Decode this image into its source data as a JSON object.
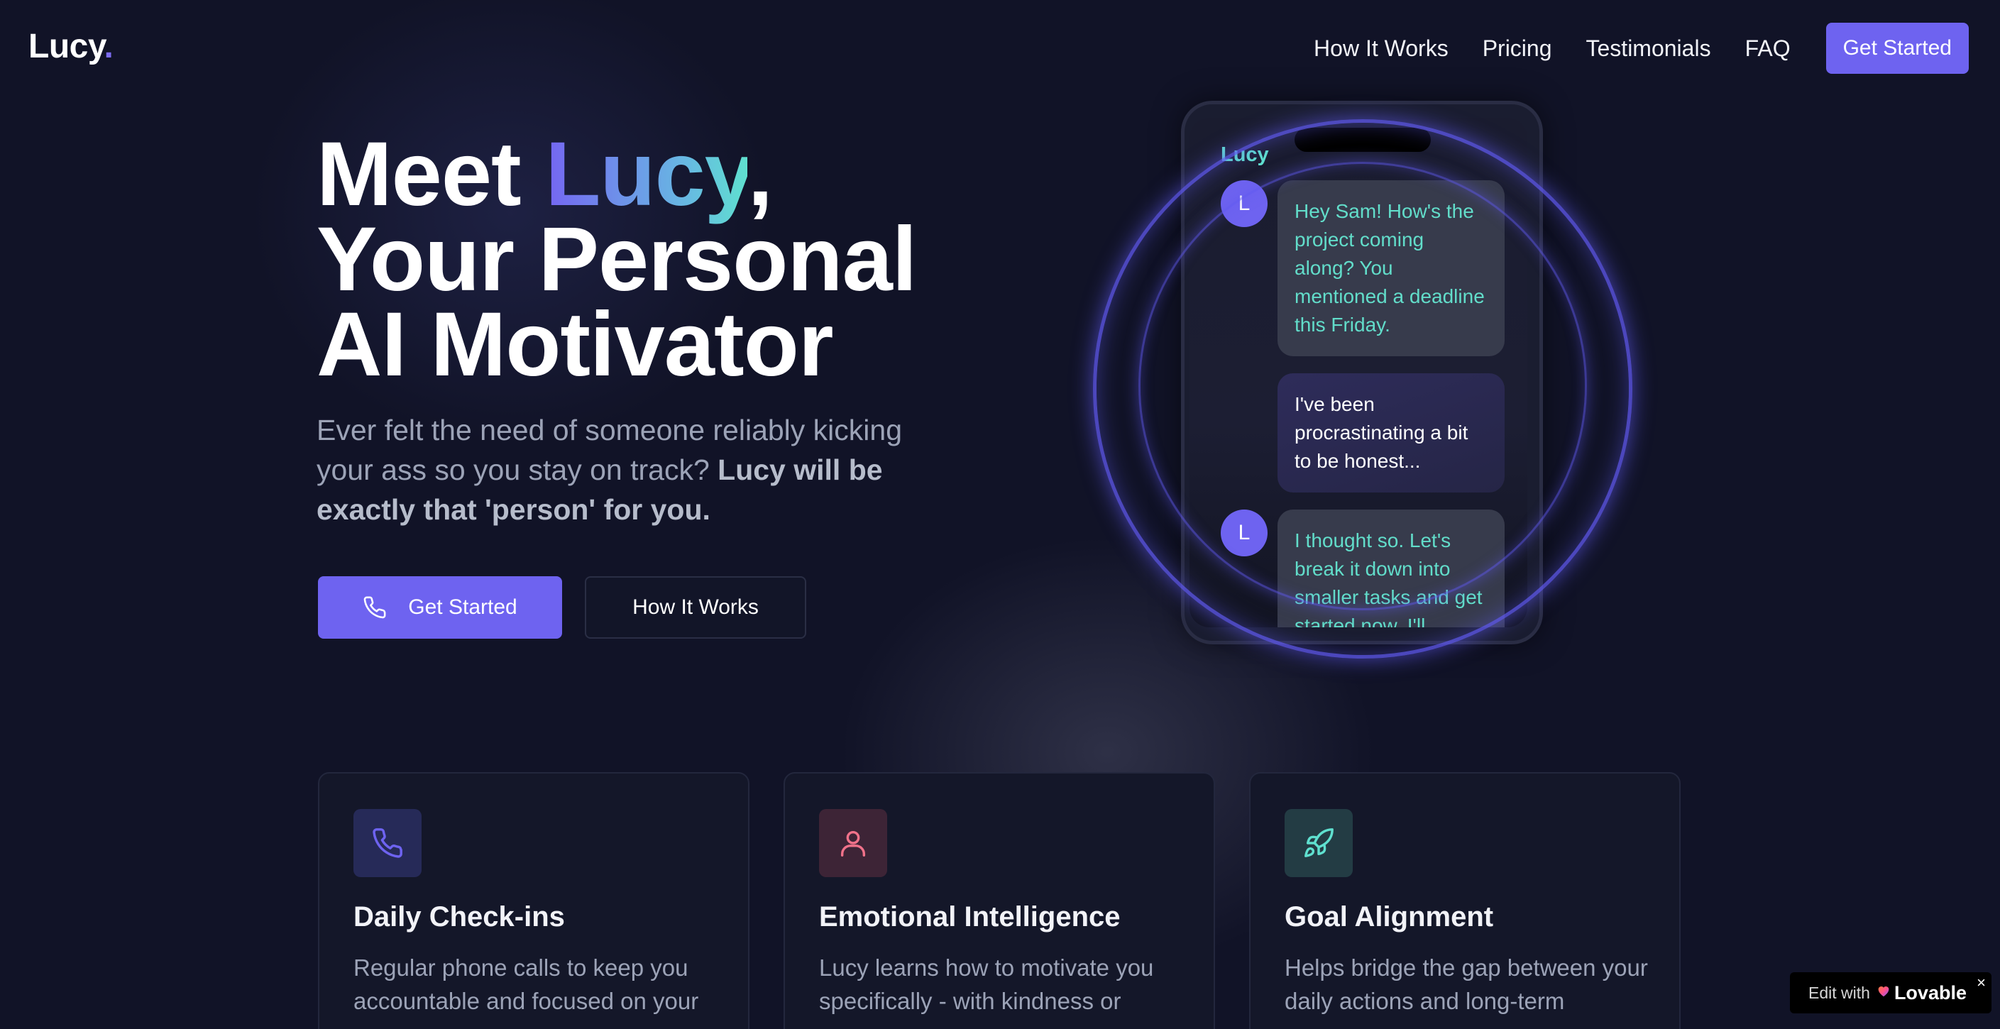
{
  "nav": {
    "logo_text": "Lucy",
    "logo_dot": ".",
    "links": [
      "How It Works",
      "Pricing",
      "Testimonials",
      "FAQ"
    ],
    "cta_label": "Get Started"
  },
  "hero": {
    "title_meet": "Meet ",
    "title_name": "Lucy",
    "title_comma": ",",
    "title_line2": "Your Personal",
    "title_line3": "AI Motivator",
    "subtitle_plain": "Ever felt the need of someone reliably kicking your ass so you stay on track? ",
    "subtitle_bold": "Lucy will be exactly that 'person' for you.",
    "primary_button": "Get Started",
    "primary_button_icon": "phone-icon",
    "secondary_button": "How It Works"
  },
  "phone": {
    "contact_name": "Lucy",
    "avatar_initial": "L",
    "messages": [
      {
        "from": "ai",
        "text": "Hey Sam! How's the project coming along? You mentioned a deadline this Friday."
      },
      {
        "from": "user",
        "text": "I've been procrastinating a bit to be honest..."
      },
      {
        "from": "ai",
        "text": "I thought so. Let's break it down into smaller tasks and get started now. I'll"
      }
    ]
  },
  "features": [
    {
      "icon": "phone-icon",
      "title": "Daily Check-ins",
      "description": "Regular phone calls to keep you accountable and focused on your"
    },
    {
      "icon": "user-icon",
      "title": "Emotional Intelligence",
      "description": "Lucy learns how to motivate you specifically - with kindness or"
    },
    {
      "icon": "rocket-icon",
      "title": "Goal Alignment",
      "description": "Helps bridge the gap between your daily actions and long-term"
    }
  ],
  "badge": {
    "prefix": "Edit with",
    "brand": "Lovable",
    "close": "×"
  },
  "colors": {
    "background": "#111327",
    "accent": "#6e63f0",
    "teal": "#5fe0cf",
    "muted_text": "#9ca3b7"
  }
}
